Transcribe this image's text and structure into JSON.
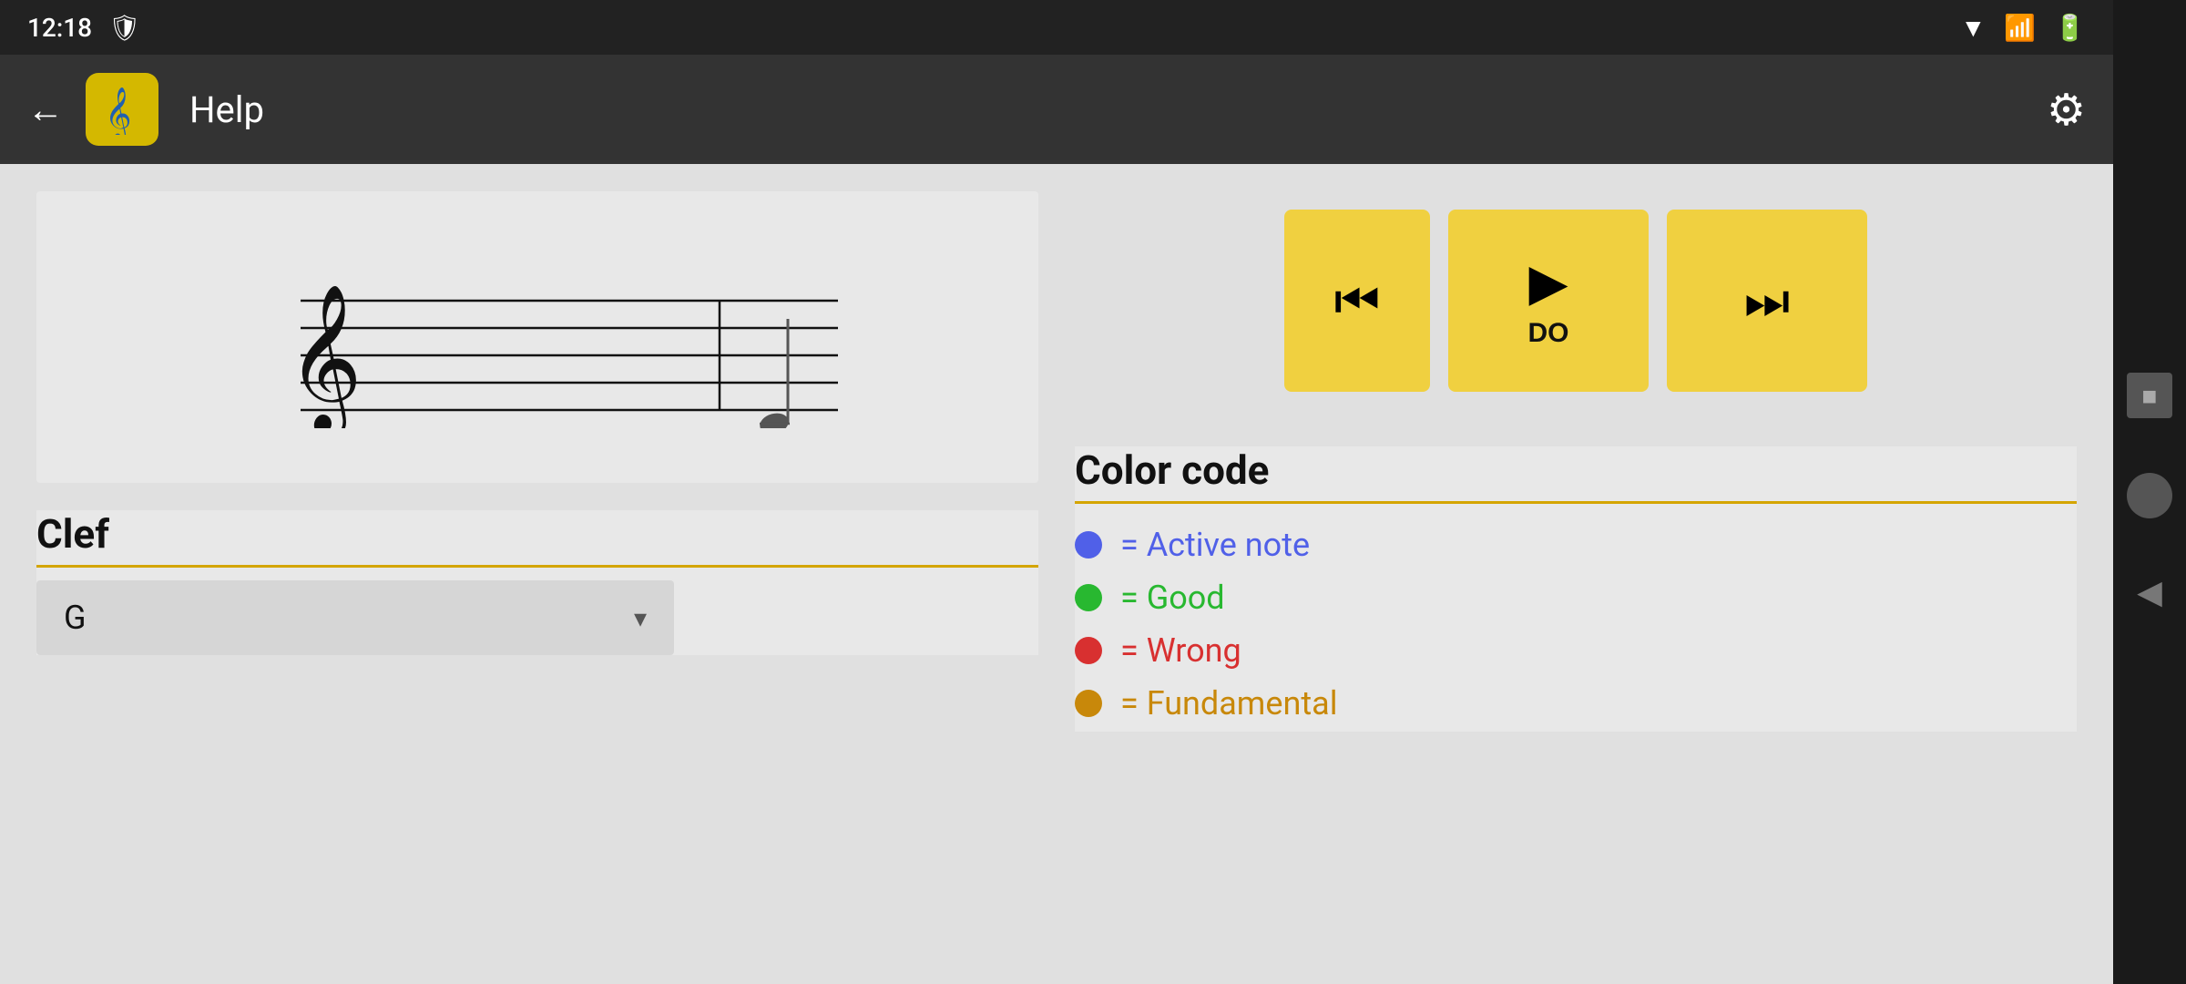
{
  "statusBar": {
    "time": "12:18",
    "shield_icon": "shield",
    "wifi_icon": "wifi",
    "signal_icon": "signal",
    "battery_icon": "battery"
  },
  "topBar": {
    "back_label": "←",
    "title": "Help",
    "settings_icon": "gear"
  },
  "staff": {
    "clef_symbol": "𝄞"
  },
  "playback": {
    "prev_icon": "⏮",
    "play_icon": "▶",
    "next_icon": "⏭",
    "note_label": "DO"
  },
  "clef": {
    "section_title": "Clef",
    "dropdown_value": "G",
    "dropdown_arrow": "▾"
  },
  "colorCode": {
    "section_title": "Color code",
    "items": [
      {
        "color": "blue",
        "label": "= Active note"
      },
      {
        "color": "green",
        "label": "= Good"
      },
      {
        "color": "red",
        "label": "= Wrong"
      },
      {
        "color": "orange",
        "label": "= Fundamental"
      }
    ]
  },
  "sideNav": {
    "square_icon": "■",
    "circle_icon": "●",
    "triangle_icon": "◀"
  }
}
